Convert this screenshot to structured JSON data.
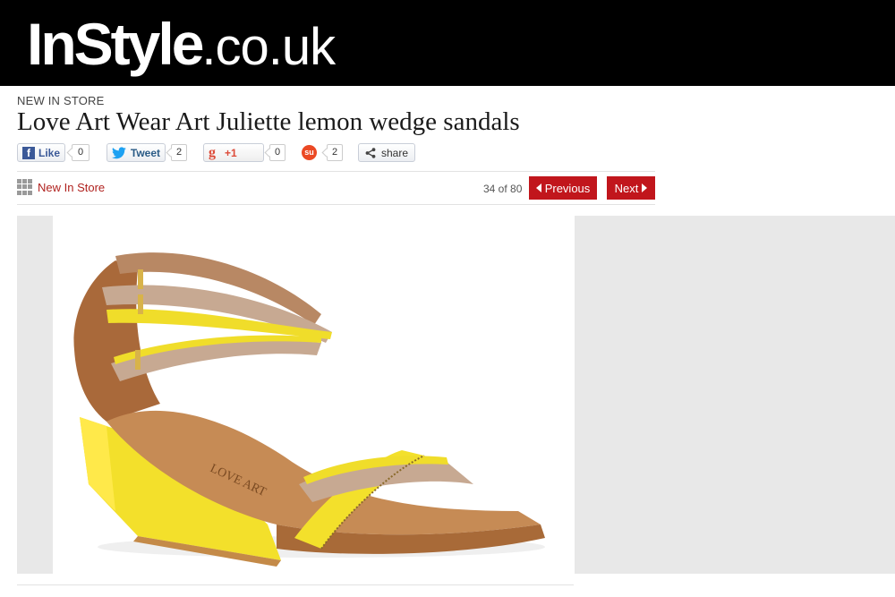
{
  "header": {
    "logo_main": "InStyle",
    "logo_suffix": ".co.uk"
  },
  "article": {
    "section_kicker": "NEW IN STORE",
    "title": "Love Art Wear Art Juliette lemon wedge sandals"
  },
  "social": {
    "facebook": {
      "label": "Like",
      "count": "0"
    },
    "twitter": {
      "label": "Tweet",
      "count": "2"
    },
    "googleplus": {
      "label": "+1",
      "count": "0"
    },
    "stumbleupon": {
      "count": "2"
    },
    "share": {
      "label": "share"
    }
  },
  "gallery": {
    "section_link": "New In Store",
    "position": "34 of 80",
    "prev_label": "Previous",
    "next_label": "Next"
  },
  "product_image": {
    "description_icon": "yellow-wedge-sandal-photo"
  },
  "colors": {
    "accent_red": "#c1161c",
    "masthead": "#000000",
    "panel_grey": "#e8e8e8"
  }
}
